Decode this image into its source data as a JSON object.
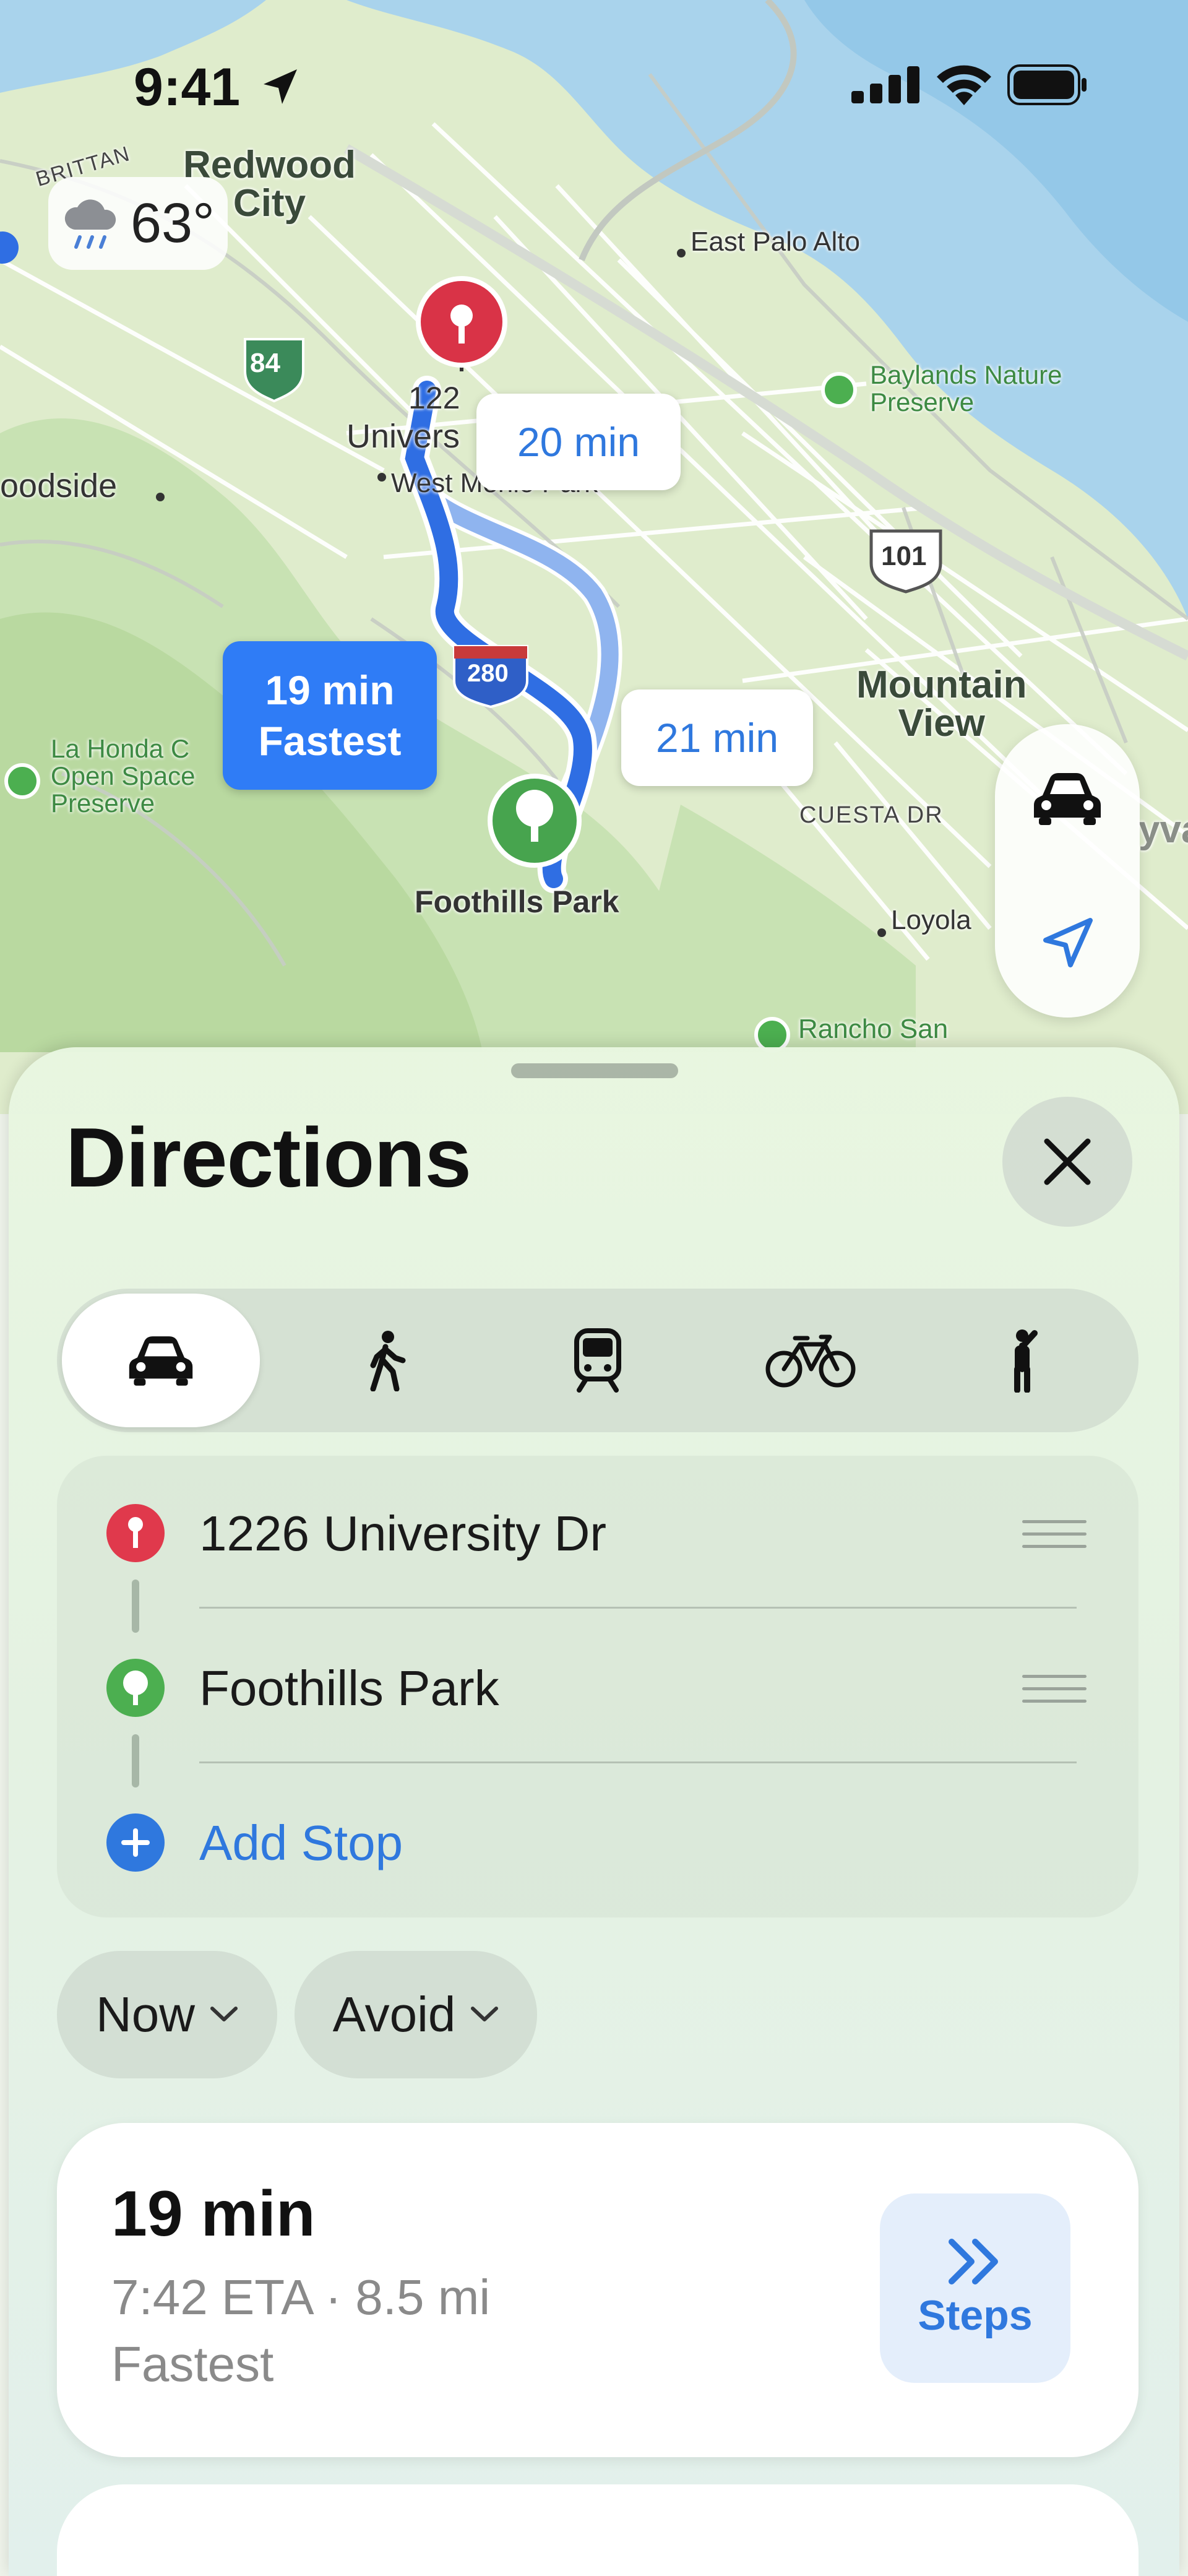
{
  "status_bar": {
    "time": "9:41"
  },
  "weather": {
    "temperature": "63°",
    "icon": "cloud-rain-icon"
  },
  "map": {
    "labels": {
      "redwood_city": "Redwood\nCity",
      "brittan": "BRITTAN",
      "east_palo_alto": "East Palo Alto",
      "baylands": "Baylands Nature\nPreserve",
      "woodside": "oodside",
      "university": "Univers",
      "address_fragment": "122",
      "west_menlo_park": "West Menlo Park",
      "mountain_view": "Mountain\nView",
      "la_honda": "La Honda C\nOpen Space\nPreserve",
      "cuesta_dr": "CUESTA DR",
      "loyola": "Loyola",
      "foothills_park": "Foothills Park",
      "rancho_san": "Rancho San",
      "sunnyvale": "yva",
      "shield_84": "84",
      "shield_101": "101",
      "shield_280": "280"
    },
    "route_bubbles": {
      "alt1": "20 min",
      "alt2": "21 min",
      "fastest_time": "19 min",
      "fastest_label": "Fastest"
    },
    "controls": [
      "car-icon",
      "location-arrow-icon"
    ]
  },
  "sheet": {
    "title": "Directions",
    "close_icon": "close-icon",
    "modes": [
      {
        "name": "drive",
        "icon": "car-icon",
        "selected": true
      },
      {
        "name": "walk",
        "icon": "walk-icon",
        "selected": false
      },
      {
        "name": "transit",
        "icon": "train-icon",
        "selected": false
      },
      {
        "name": "cycle",
        "icon": "bicycle-icon",
        "selected": false
      },
      {
        "name": "rideshare",
        "icon": "person-hail-icon",
        "selected": false
      }
    ],
    "stops": [
      {
        "label": "1226 University Dr",
        "icon": "pin-icon",
        "color": "#e0394c"
      },
      {
        "label": "Foothills Park",
        "icon": "tree-icon",
        "color": "#4caf50"
      }
    ],
    "add_stop": "Add Stop",
    "options": {
      "time": "Now",
      "avoid": "Avoid"
    },
    "route": {
      "duration": "19 min",
      "details": "7:42 ETA · 8.5 mi",
      "tag": "Fastest",
      "steps_label": "Steps"
    }
  },
  "colors": {
    "accent": "#2f78de",
    "fastest": "#2f7cf6",
    "origin": "#e0394c",
    "destination": "#4caf50"
  }
}
